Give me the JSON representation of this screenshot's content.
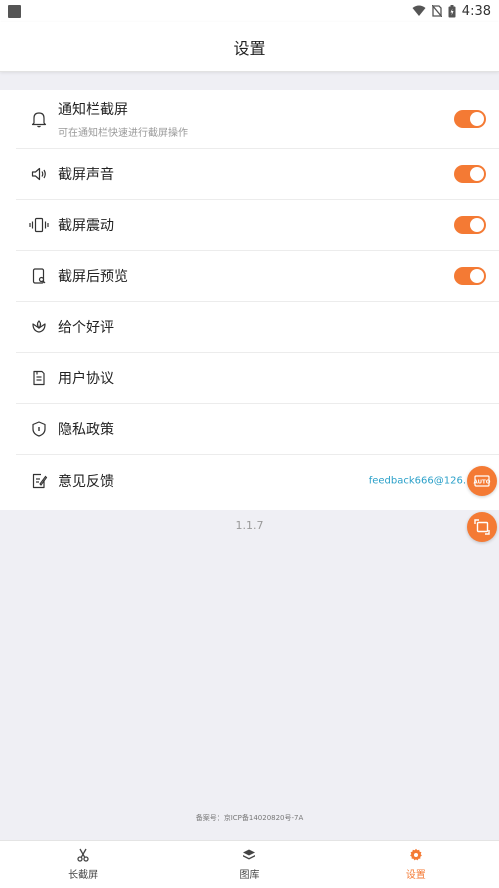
{
  "status_bar": {
    "time": "4:38"
  },
  "header": {
    "title": "设置"
  },
  "settings": [
    {
      "label": "通知栏截屏",
      "sub": "可在通知栏快速进行截屏操作",
      "icon": "bell-icon",
      "toggle": true
    },
    {
      "label": "截屏声音",
      "icon": "speaker-icon",
      "toggle": true
    },
    {
      "label": "截屏震动",
      "icon": "vibrate-icon",
      "toggle": true
    },
    {
      "label": "截屏后预览",
      "icon": "preview-icon",
      "toggle": true
    },
    {
      "label": "给个好评",
      "icon": "lotus-icon"
    },
    {
      "label": "用户协议",
      "icon": "document-icon"
    },
    {
      "label": "隐私政策",
      "icon": "shield-icon"
    },
    {
      "label": "意见反馈",
      "icon": "feedback-icon",
      "email": "feedback666@126."
    }
  ],
  "version": "1.1.7",
  "icp": "备案号：京ICP备14020820号-7A",
  "bottom_nav": [
    {
      "label": "长截屏",
      "icon": "scissors-icon",
      "active": false
    },
    {
      "label": "图库",
      "icon": "layers-icon",
      "active": false
    },
    {
      "label": "设置",
      "icon": "gear-icon",
      "active": true
    }
  ],
  "colors": {
    "accent": "#f47a34",
    "link": "#2aa0c9",
    "background": "#efeff4"
  }
}
